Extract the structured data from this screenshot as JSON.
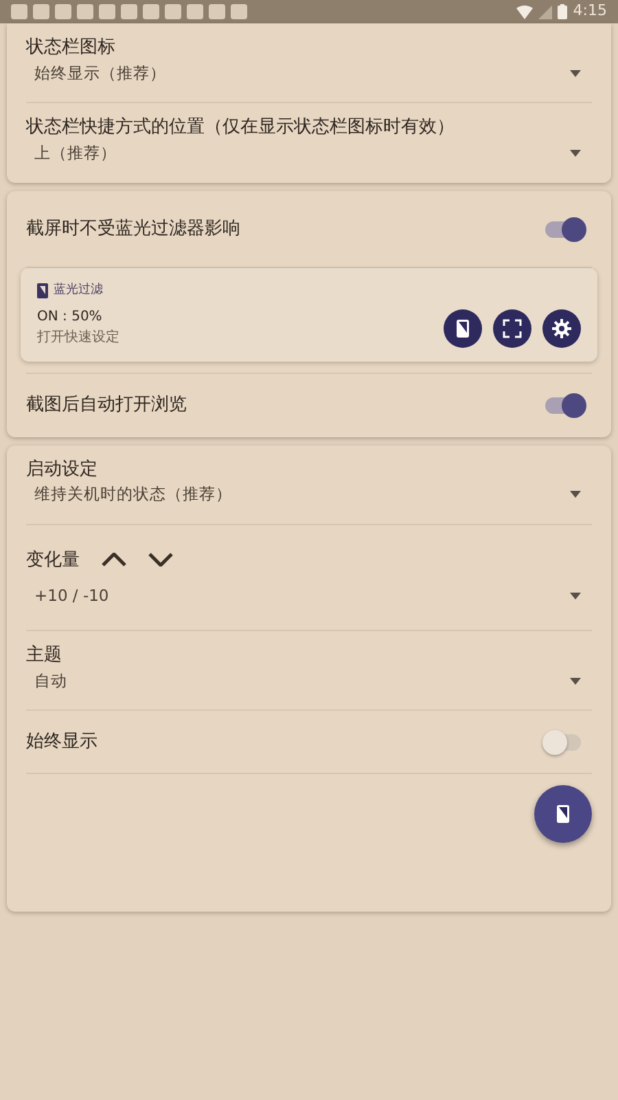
{
  "status_bar": {
    "time": "4:15"
  },
  "sections": [
    {
      "items": [
        {
          "kind": "dropdown",
          "label": "状态栏图标",
          "value": "始终显示（推荐）"
        },
        {
          "kind": "dropdown",
          "label": "状态栏快捷方式的位置（仅在显示状态栏图标时有效）",
          "value": "上（推荐）"
        }
      ]
    },
    {
      "items": [
        {
          "kind": "toggle",
          "label": "截屏时不受蓝光过滤器影响",
          "on": true
        },
        {
          "kind": "tile",
          "title": "蓝光过滤",
          "status": "ON : 50%",
          "subtitle": "打开快速设定"
        },
        {
          "kind": "toggle",
          "label": "截图后自动打开浏览",
          "on": true
        }
      ]
    },
    {
      "items": [
        {
          "kind": "dropdown",
          "label": "启动设定",
          "value": "维持关机时的状态（推荐）"
        },
        {
          "kind": "stepper",
          "label": "变化量",
          "value": "+10 / -10"
        },
        {
          "kind": "dropdown",
          "label": "主题",
          "value": "自动"
        },
        {
          "kind": "toggle",
          "label": "始终显示",
          "on": false
        },
        {
          "kind": "fab"
        }
      ]
    }
  ]
}
